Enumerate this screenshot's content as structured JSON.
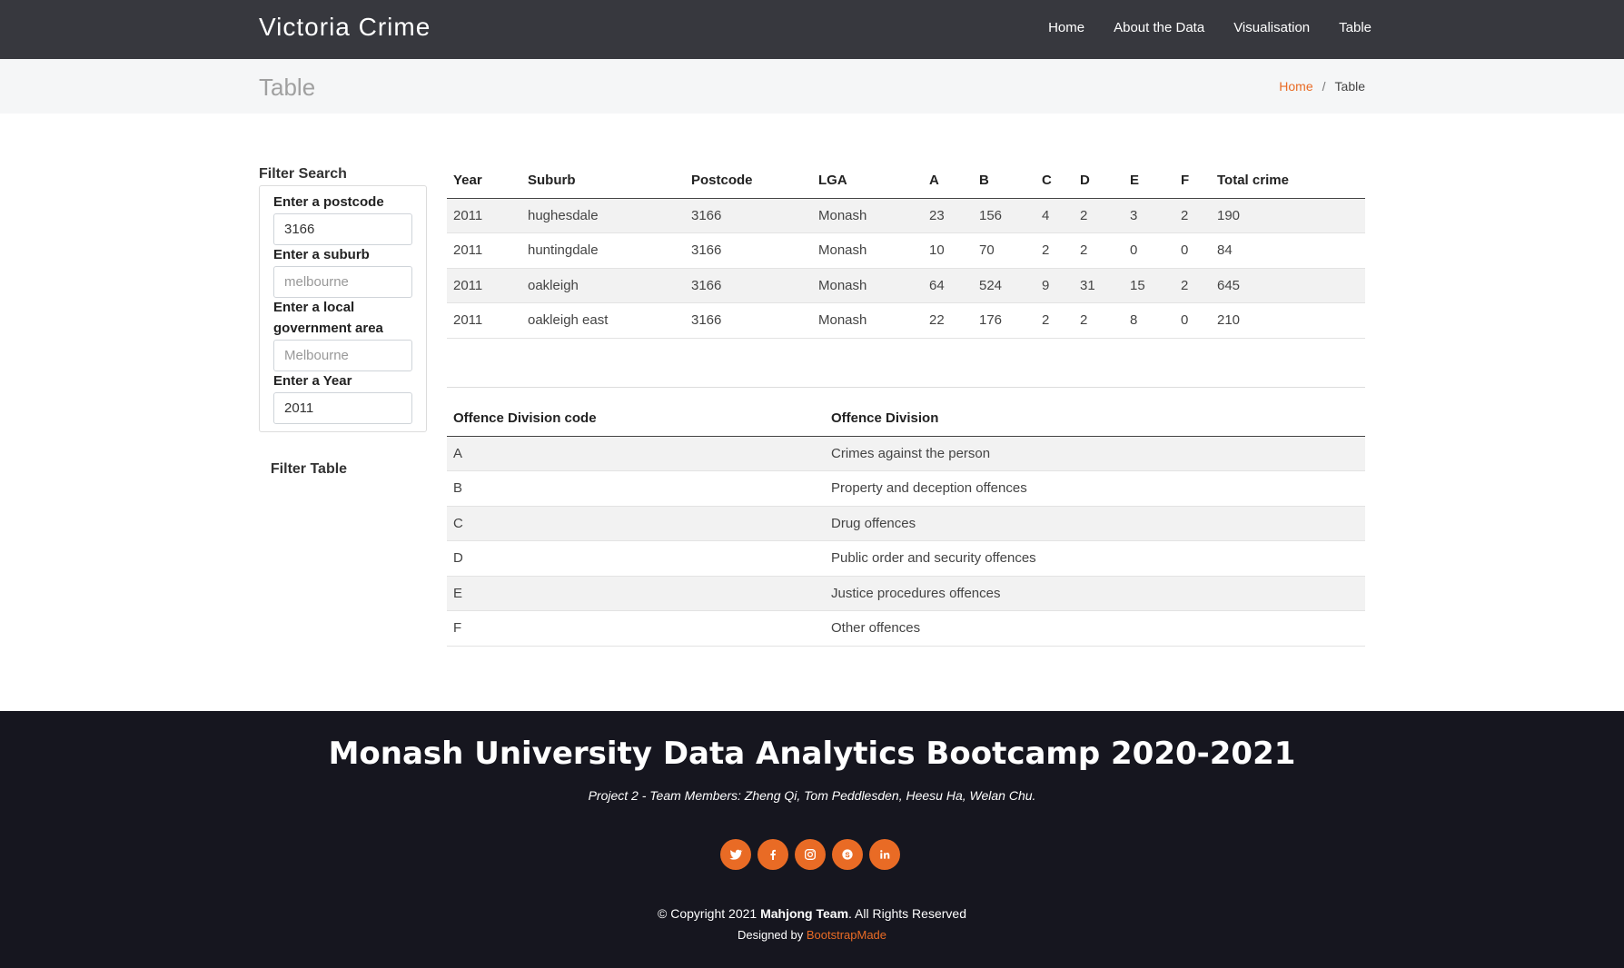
{
  "header": {
    "brand": "Victoria Crime",
    "nav": [
      "Home",
      "About the Data",
      "Visualisation",
      "Table"
    ]
  },
  "breadcrumb": {
    "title": "Table",
    "home": "Home",
    "separator": "/",
    "current": "Table"
  },
  "filter": {
    "heading": "Filter Search",
    "postcode_label": "Enter a postcode",
    "postcode_value": "3166",
    "suburb_label": "Enter a suburb",
    "suburb_placeholder": "melbourne",
    "lga_label": "Enter a local government area",
    "lga_placeholder": "Melbourne",
    "year_label": "Enter a Year",
    "year_value": "2011",
    "button": "Filter Table"
  },
  "crime_table": {
    "columns": [
      "Year",
      "Suburb",
      "Postcode",
      "LGA",
      "A",
      "B",
      "C",
      "D",
      "E",
      "F",
      "Total crime"
    ],
    "rows": [
      [
        "2011",
        "hughesdale",
        "3166",
        "Monash",
        "23",
        "156",
        "4",
        "2",
        "3",
        "2",
        "190"
      ],
      [
        "2011",
        "huntingdale",
        "3166",
        "Monash",
        "10",
        "70",
        "2",
        "2",
        "0",
        "0",
        "84"
      ],
      [
        "2011",
        "oakleigh",
        "3166",
        "Monash",
        "64",
        "524",
        "9",
        "31",
        "15",
        "2",
        "645"
      ],
      [
        "2011",
        "oakleigh east",
        "3166",
        "Monash",
        "22",
        "176",
        "2",
        "2",
        "8",
        "0",
        "210"
      ]
    ]
  },
  "offence_table": {
    "columns": [
      "Offence Division code",
      "Offence Division"
    ],
    "rows": [
      [
        "A",
        "Crimes against the person"
      ],
      [
        "B",
        "Property and deception offences"
      ],
      [
        "C",
        "Drug offences"
      ],
      [
        "D",
        "Public order and security offences"
      ],
      [
        "E",
        "Justice procedures offences"
      ],
      [
        "F",
        "Other offences"
      ]
    ]
  },
  "footer": {
    "title": "Monash University Data Analytics Bootcamp 2020-2021",
    "subtitle": "Project 2 - Team Members: Zheng Qi, Tom Peddlesden, Heesu Ha, Welan Chu.",
    "social_icons": [
      "twitter-icon",
      "facebook-icon",
      "instagram-icon",
      "skype-icon",
      "linkedin-icon"
    ],
    "copyright_prefix": "© Copyright 2021",
    "copyright_team": "Mahjong Team",
    "copyright_suffix": ". All Rights Reserved",
    "designed_by": "Designed by",
    "designer": "BootstrapMade"
  },
  "colors": {
    "header_bg": "#37383e",
    "accent": "#e96b25",
    "footer_bg": "#16161f",
    "crumb_bg": "#f5f6f7"
  }
}
